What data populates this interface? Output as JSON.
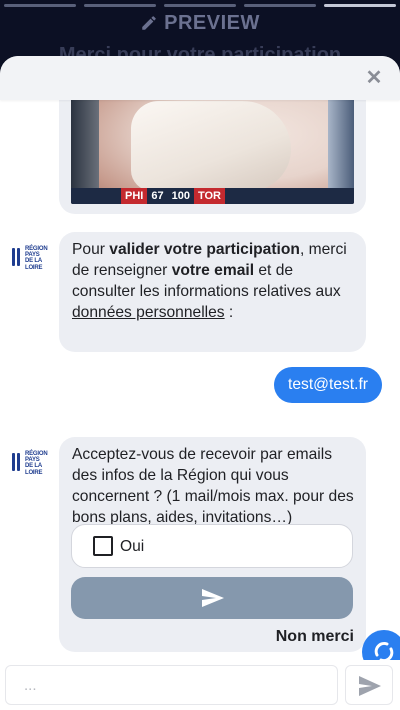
{
  "background": {
    "header_label": "PREVIEW",
    "title": "Merci pour votre participation"
  },
  "media": {
    "scoreboard": [
      "PHI",
      "67",
      "100",
      "TOR"
    ]
  },
  "messages": {
    "bot_logo": {
      "line1": "RÉGION",
      "line2": "PAYS",
      "line3": "DE LA LOIRE"
    },
    "participation": {
      "t1": "Pour ",
      "b1": "valider votre participation",
      "t2": ", merci de renseigner ",
      "b2": "votre email",
      "t3": " et de consulter les informations relatives aux ",
      "link": "données personnelles",
      "t4": " :"
    },
    "user_email": "test@test.fr",
    "newsletter_question": "Acceptez-vous de recevoir par emails des infos de la Région qui vous concernent ? (1 mail/mois max. pour des bons plans, aides, invitations…)",
    "option_label": "Oui",
    "decline_label": "Non merci"
  },
  "composer": {
    "placeholder": "..."
  },
  "colors": {
    "accent": "#2a7ff0",
    "bubble": "#eceef3",
    "submit_disabled": "#8598ad",
    "brand": "#1f3d8f"
  }
}
